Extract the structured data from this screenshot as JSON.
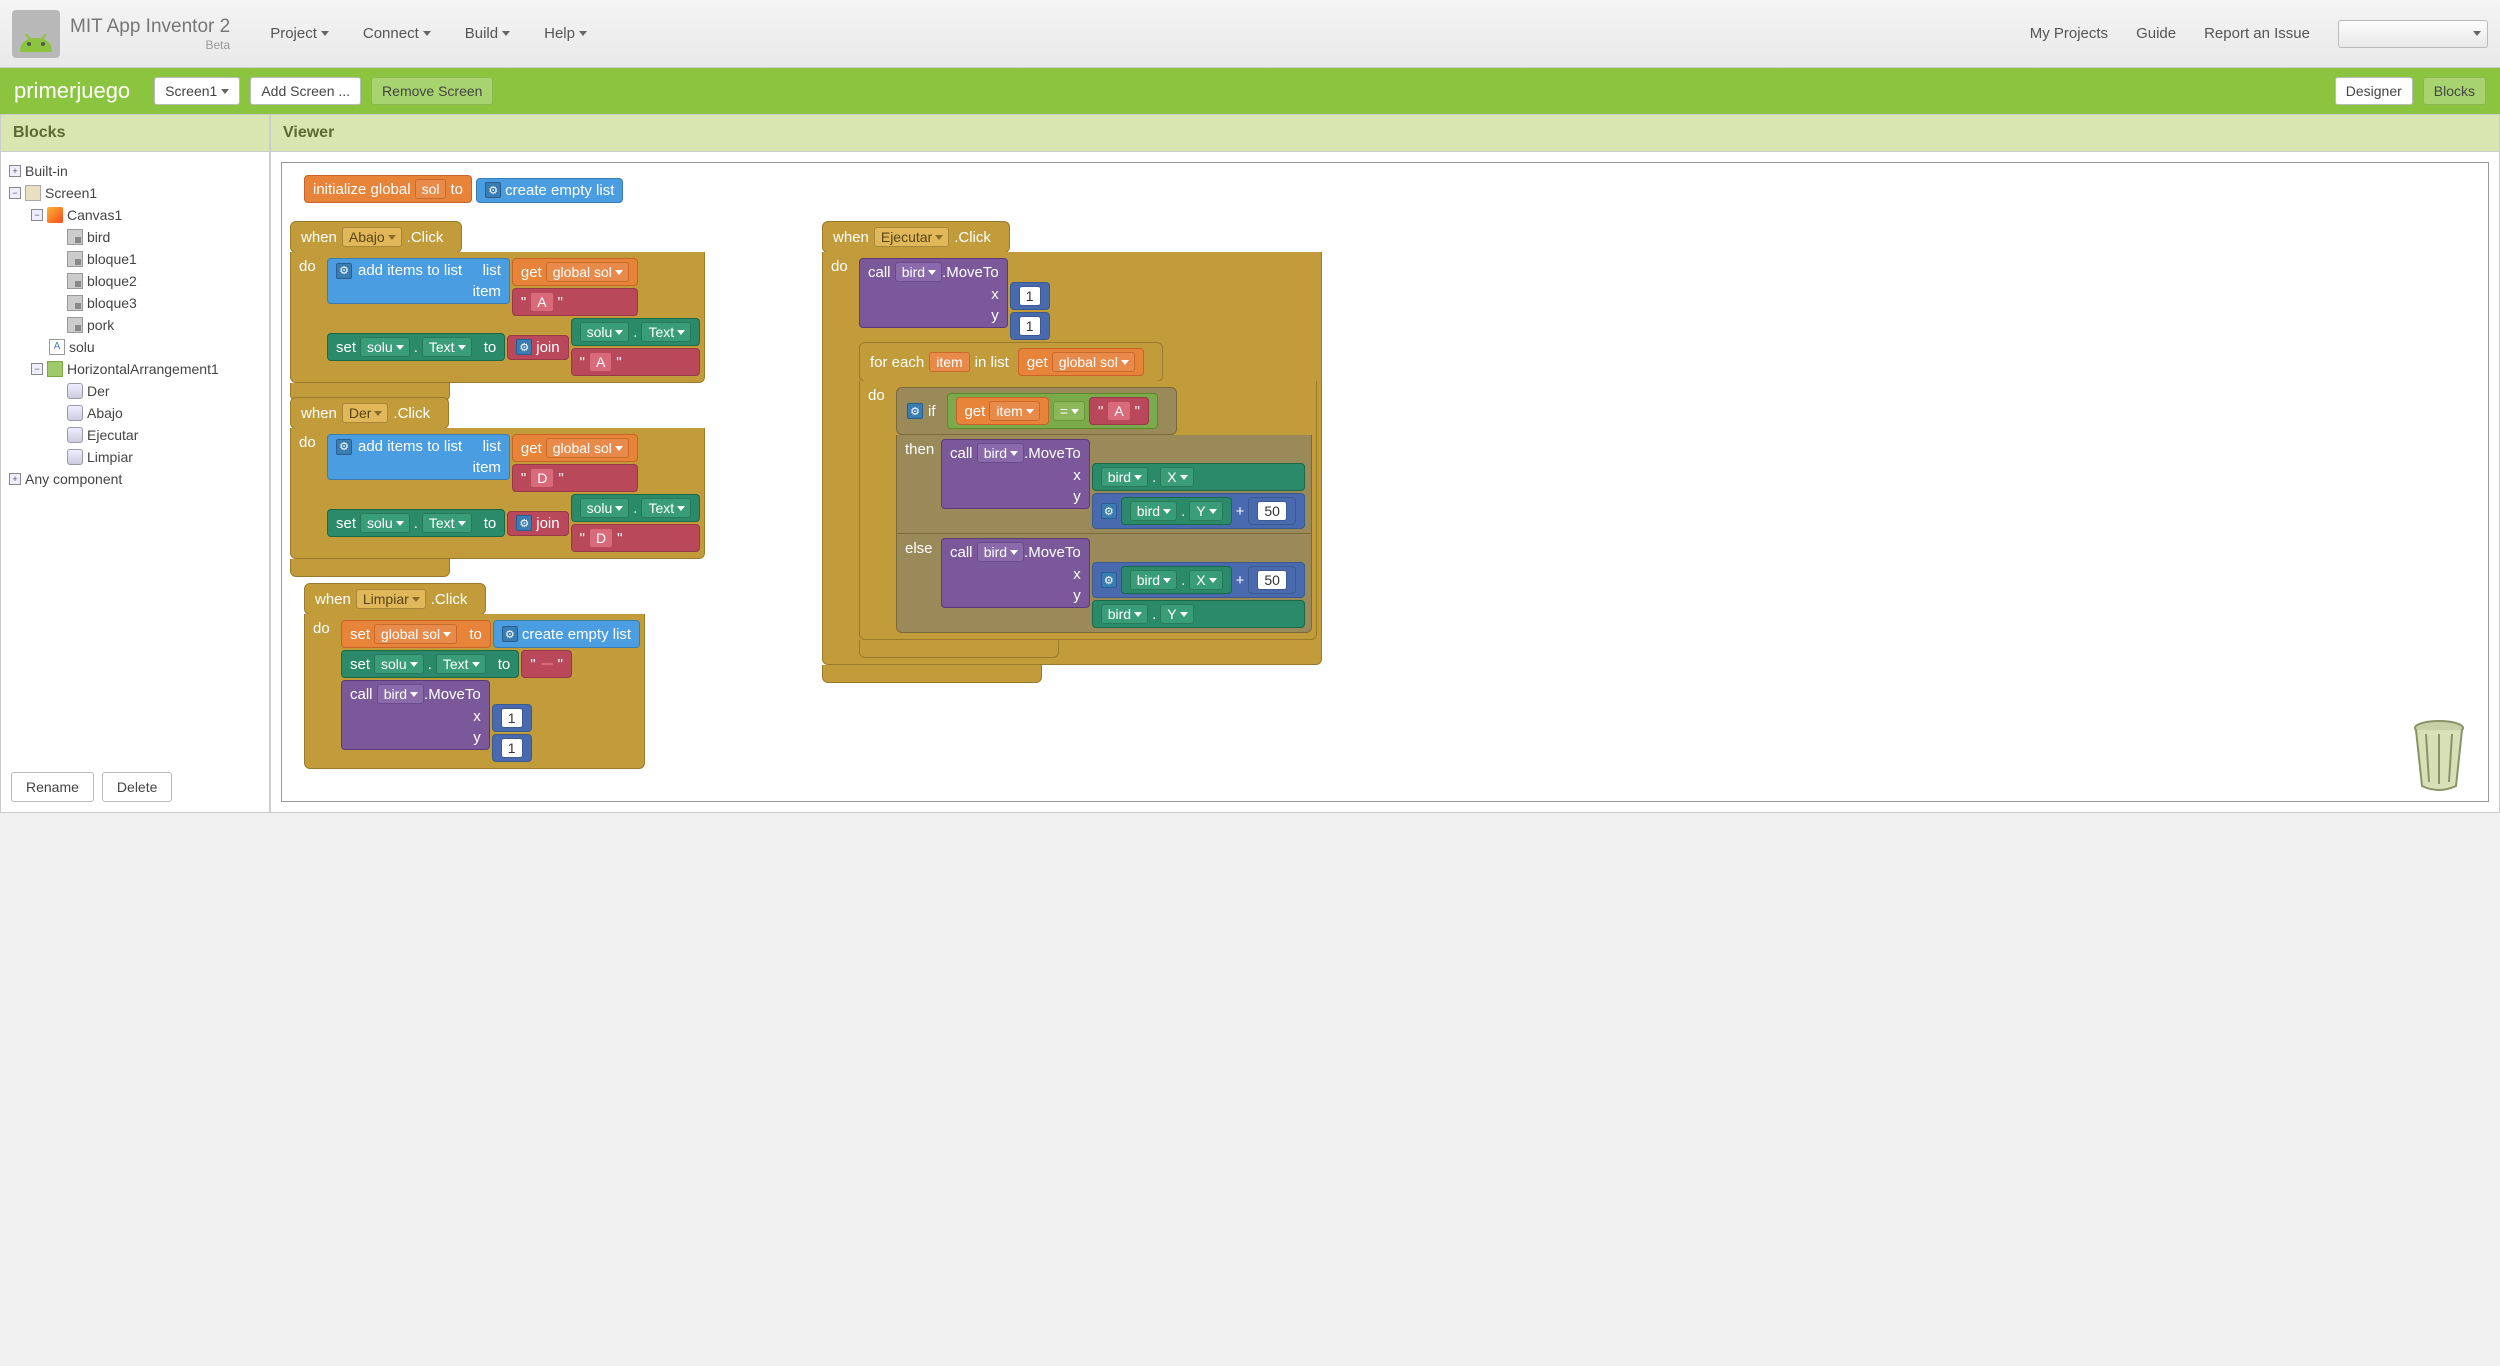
{
  "header": {
    "title": "MIT App Inventor 2",
    "beta": "Beta",
    "menus": [
      "Project",
      "Connect",
      "Build",
      "Help"
    ],
    "right": [
      "My Projects",
      "Guide",
      "Report an Issue"
    ]
  },
  "greenbar": {
    "project": "primerjuego",
    "screen_dd": "Screen1",
    "add_screen": "Add Screen ...",
    "remove_screen": "Remove Screen",
    "designer": "Designer",
    "blocks": "Blocks"
  },
  "panels": {
    "blocks": "Blocks",
    "viewer": "Viewer"
  },
  "tree": {
    "builtin": "Built-in",
    "screen": "Screen1",
    "canvas": "Canvas1",
    "sprites": [
      "bird",
      "bloque1",
      "bloque2",
      "bloque3",
      "pork"
    ],
    "solu": "solu",
    "harr": "HorizontalArrangement1",
    "buttons": [
      "Der",
      "Abajo",
      "Ejecutar",
      "Limpiar"
    ],
    "any": "Any component",
    "rename": "Rename",
    "delete": "Delete"
  },
  "bl": {
    "init_global": "initialize global",
    "sol": "sol",
    "to": "to",
    "create_empty": "create empty list",
    "when": "when",
    "click": ".Click",
    "do": "do",
    "add_items": "add items to list",
    "list": "list",
    "item": "item",
    "get": "get",
    "global_sol": "global sol",
    "set": "set",
    "solu": "solu",
    "text_prop": "Text",
    "join": "join",
    "A": "A",
    "D": "D",
    "call": "call",
    "bird": "bird",
    "moveto": ".MoveTo",
    "x": "x",
    "y": "y",
    "one": "1",
    "for_each": "for each",
    "in_list": "in list",
    "item_var": "item",
    "if": "if",
    "then": "then",
    "else": "else",
    "eq": "=",
    "X": "X",
    "Y": "Y",
    "plus": "+",
    "fifty": "50",
    "Abajo": "Abajo",
    "Der": "Der",
    "Ejecutar": "Ejecutar",
    "Limpiar": "Limpiar",
    "empty_str": " "
  }
}
